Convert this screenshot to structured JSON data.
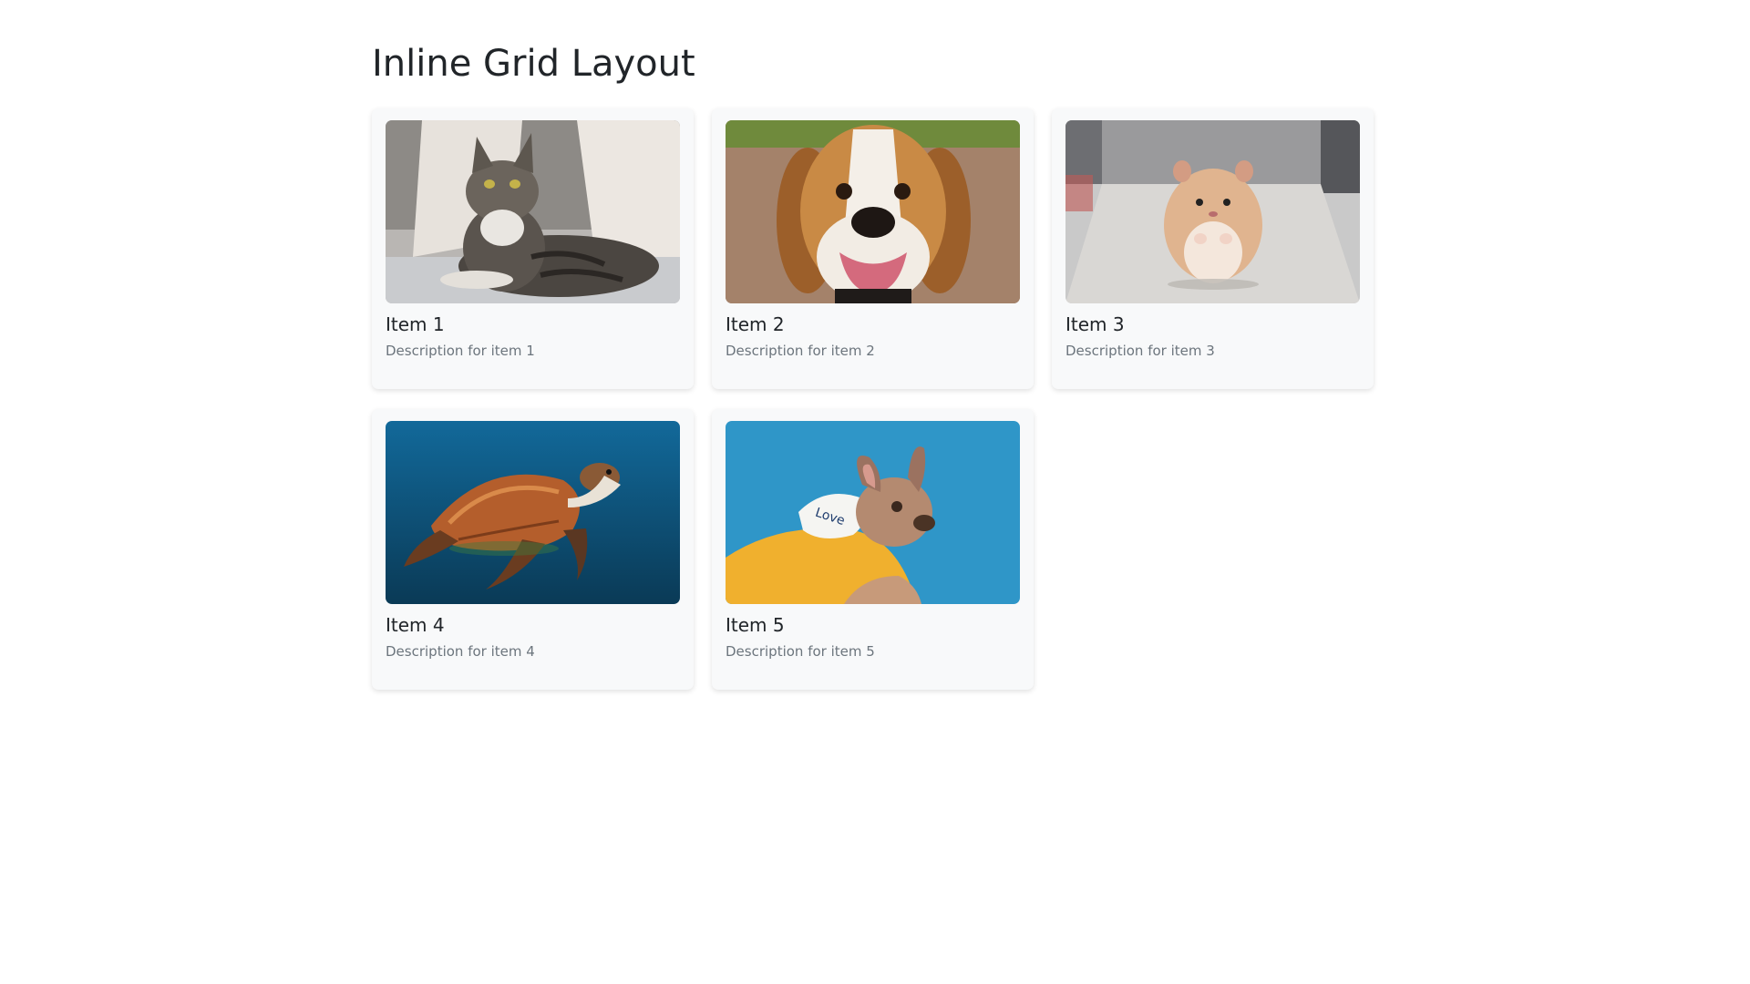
{
  "page": {
    "title": "Inline Grid Layout"
  },
  "items": [
    {
      "title": "Item 1",
      "description": "Description for item 1",
      "image": "cat-photo"
    },
    {
      "title": "Item 2",
      "description": "Description for item 2",
      "image": "beagle-photo"
    },
    {
      "title": "Item 3",
      "description": "Description for item 3",
      "image": "hamster-photo"
    },
    {
      "title": "Item 4",
      "description": "Description for item 4",
      "image": "sea-turtle-photo"
    },
    {
      "title": "Item 5",
      "description": "Description for item 5",
      "image": "french-bulldog-photo"
    }
  ]
}
